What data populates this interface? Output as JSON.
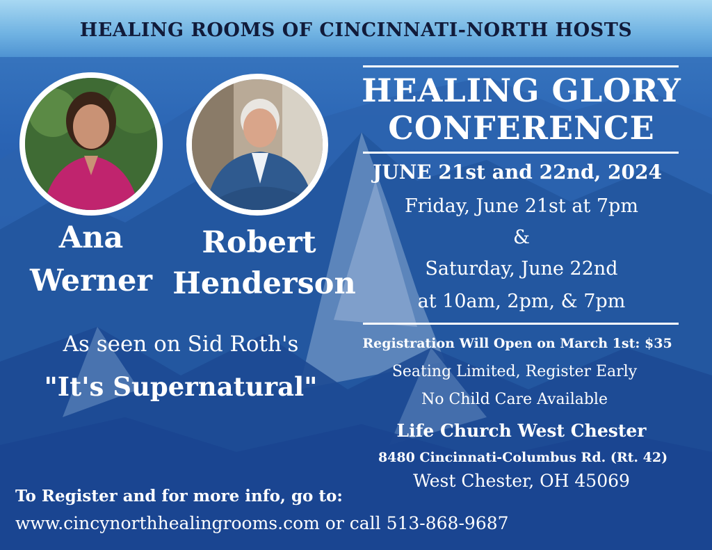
{
  "header": {
    "host_line": "HEALING ROOMS OF CINCINNATI-NORTH HOSTS"
  },
  "speakers": [
    {
      "first": "Ana",
      "last": "Werner"
    },
    {
      "first": "Robert",
      "last": "Henderson"
    }
  ],
  "event": {
    "title_line1": "HEALING GLORY",
    "title_line2": "CONFERENCE",
    "dates": "JUNE 21st and 22nd, 2024",
    "friday": "Friday, June 21st at 7pm",
    "amp": "&",
    "saturday": "Saturday, June 22nd",
    "saturday_times": "at 10am, 2pm, & 7pm"
  },
  "tv": {
    "seen_on": "As seen on Sid Roth's",
    "show": "\"It's Supernatural\""
  },
  "registration": {
    "open": "Registration Will Open on March 1st: $35",
    "seating": "Seating Limited, Register Early",
    "childcare": "No Child Care Available"
  },
  "venue": {
    "name": "Life Church West Chester",
    "street": "8480 Cincinnati-Columbus Rd. (Rt. 42)",
    "city": "West Chester, OH 45069"
  },
  "contact": {
    "prompt": "To Register and for more info, go to:",
    "line": "www.cincynorthhealingrooms.com or call 513-868-9687"
  },
  "colors": {
    "header_text": "#111b3a",
    "text": "#ffffff",
    "sky": "#a8d8f2",
    "mountain": "#1f4f9e"
  }
}
